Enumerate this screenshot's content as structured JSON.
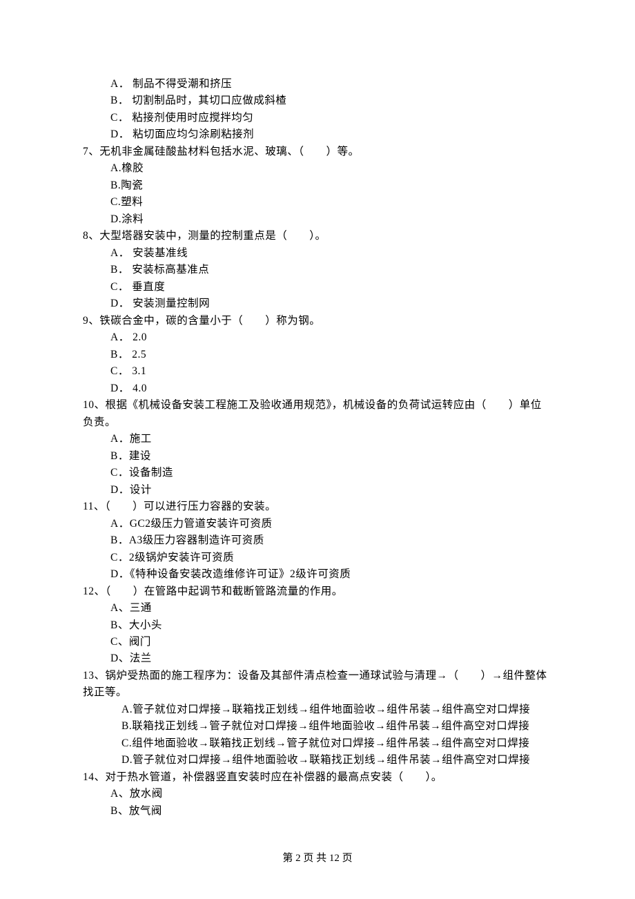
{
  "q6_options": {
    "a": "A． 制品不得受潮和挤压",
    "b": "B． 切割制品时，其切口应做成斜楂",
    "c": "C． 粘接剂使用时应搅拌均匀",
    "d": "D． 粘切面应均匀涂刷粘接剂"
  },
  "q7": {
    "stem": "7、无机非金属硅酸盐材料包括水泥、玻璃、（　　）等。",
    "a": "A.橡胶",
    "b": "B.陶瓷",
    "c": "C.塑料",
    "d": "D.涂料"
  },
  "q8": {
    "stem": "8、大型塔器安装中，测量的控制重点是（　　）。",
    "a": "A． 安装基准线",
    "b": "B． 安装标高基准点",
    "c": "C． 垂直度",
    "d": "D． 安装测量控制网"
  },
  "q9": {
    "stem": "9、铁碳合金中，碳的含量小于（　　）称为钢。",
    "a": "A． 2.0",
    "b": "B． 2.5",
    "c": "C． 3.1",
    "d": "D． 4.0"
  },
  "q10": {
    "stem": "10、根据《机械设备安装工程施工及验收通用规范》，机械设备的负荷试运转应由（　　）单位负责。",
    "a": "A．施工",
    "b": "B．建设",
    "c": "C．设备制造",
    "d": "D．设计"
  },
  "q11": {
    "stem": "11、（　　）可以进行压力容器的安装。",
    "a": "A．GC2级压力管道安装许可资质",
    "b": "B．A3级压力容器制造许可资质",
    "c": "C．2级锅炉安装许可资质",
    "d": "D．《特种设备安装改造维修许可证》2级许可资质"
  },
  "q12": {
    "stem": "12、（　　）在管路中起调节和截断管路流量的作用。",
    "a": "A、三通",
    "b": "B、大小头",
    "c": "C、阀门",
    "d": "D、法兰"
  },
  "q13": {
    "stem": "13、锅炉受热面的施工程序为：设备及其部件清点检查一通球试验与清理→（　　）→组件整体找正等。",
    "a": "A.管子就位对口焊接→联箱找正划线→组件地面验收→组件吊装→组件高空对口焊接",
    "b": "B.联箱找正划线→管子就位对口焊接→组件地面验收→组件吊装→组件高空对口焊接",
    "c": "C.组件地面验收→联箱找正划线→管子就位对口焊接→组件吊装→组件高空对口焊接",
    "d": "D.管子就位对口焊接→组件地面验收→联箱找正划线→组件吊装→组件高空对口焊接"
  },
  "q14": {
    "stem": "14、对于热水管道，补偿器竖直安装时应在补偿器的最高点安装（　　）。",
    "a": "A、放水阀",
    "b": "B、放气阀"
  },
  "footer": "第 2 页 共 12 页"
}
